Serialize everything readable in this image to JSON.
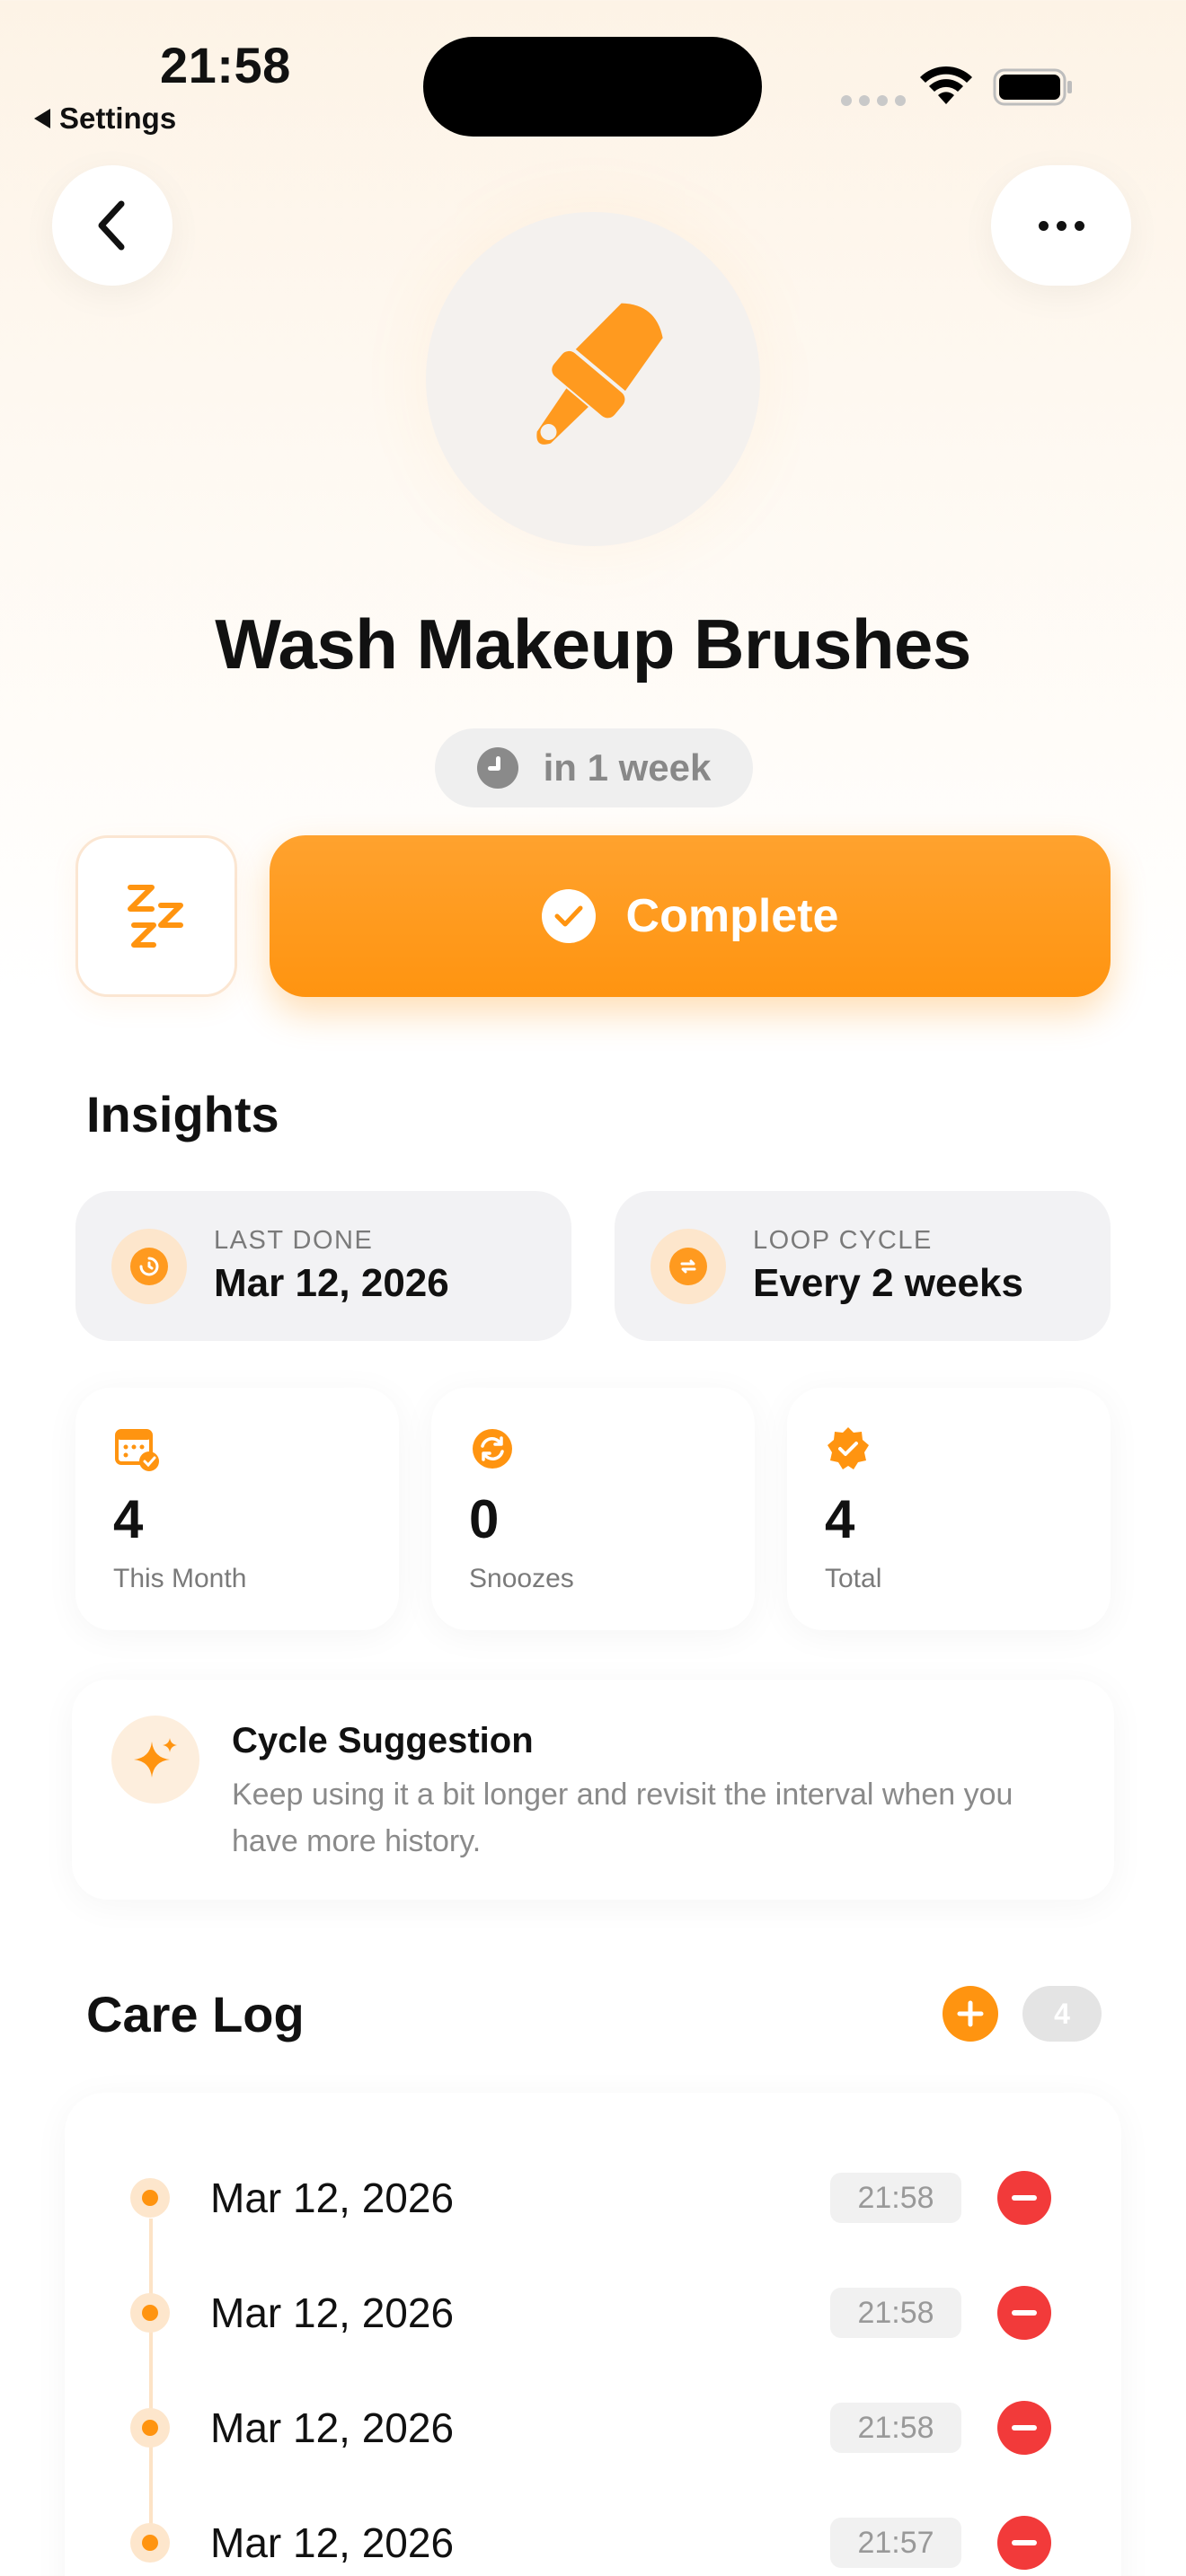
{
  "status_bar": {
    "time": "21:58",
    "back_app": "Settings"
  },
  "header": {
    "back_icon": "chevron-left-icon",
    "more_icon": "ellipsis-icon"
  },
  "task": {
    "icon": "paintbrush-icon",
    "title": "Wash Makeup Brushes",
    "due_text": "in 1 week",
    "complete_label": "Complete",
    "snooze_glyph": "zzz-icon",
    "accent": "#ff9410"
  },
  "insights": {
    "title": "Insights",
    "last_done": {
      "label": "LAST DONE",
      "value": "Mar 12, 2026"
    },
    "loop_cycle": {
      "label": "LOOP CYCLE",
      "value": "Every 2 weeks"
    },
    "stats": [
      {
        "value": "4",
        "label": "This Month"
      },
      {
        "value": "0",
        "label": "Snoozes"
      },
      {
        "value": "4",
        "label": "Total"
      }
    ],
    "suggestion": {
      "title": "Cycle Suggestion",
      "text": "Keep using it a bit longer and revisit the interval when you have more history."
    }
  },
  "care_log": {
    "title": "Care Log",
    "count": "4",
    "entries": [
      {
        "date": "Mar 12, 2026",
        "time": "21:58"
      },
      {
        "date": "Mar 12, 2026",
        "time": "21:58"
      },
      {
        "date": "Mar 12, 2026",
        "time": "21:58"
      },
      {
        "date": "Mar 12, 2026",
        "time": "21:57"
      }
    ]
  }
}
